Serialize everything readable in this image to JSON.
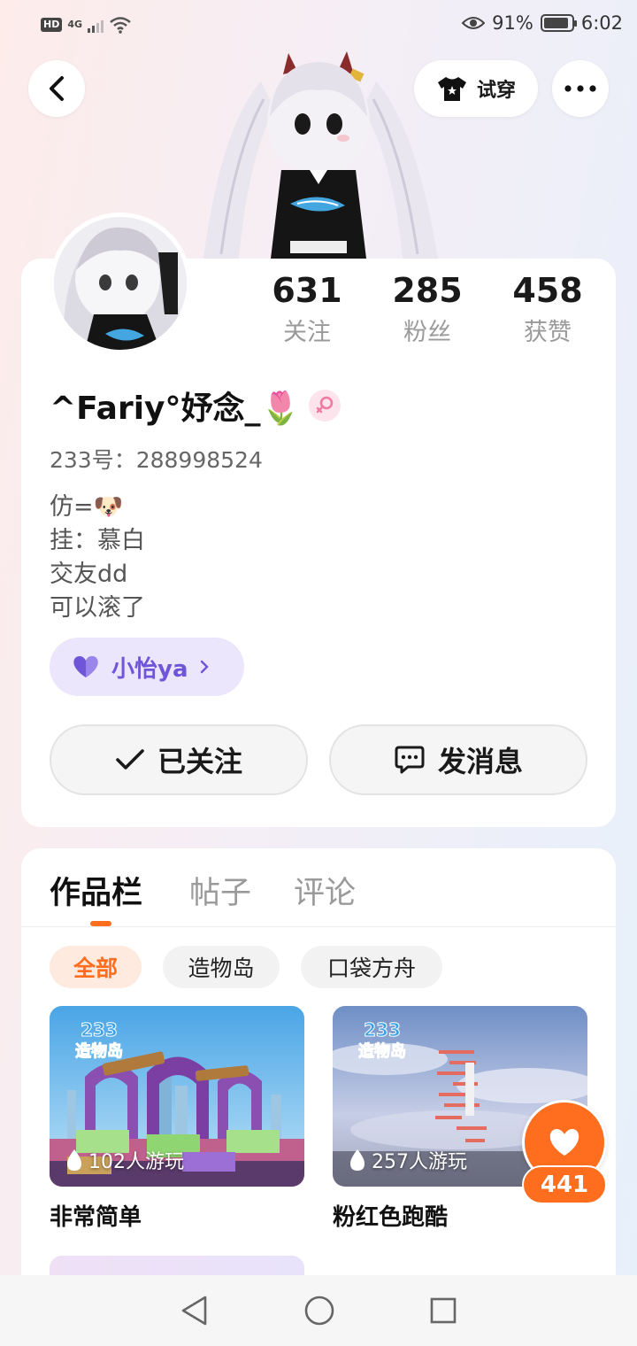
{
  "status_bar": {
    "hd": "HD",
    "network": "4G",
    "battery_percent": "91%",
    "time": "6:02",
    "battery_level": 0.91
  },
  "header": {
    "tryon_label": "试穿"
  },
  "profile": {
    "stats": [
      {
        "value": "631",
        "label": "关注"
      },
      {
        "value": "285",
        "label": "粉丝"
      },
      {
        "value": "458",
        "label": "获赞"
      }
    ],
    "nickname": "^Fariy°妤念_🌷",
    "uid": "233号：288998524",
    "bio": [
      "仿=🐶",
      "挂：慕白",
      "交友dd",
      "可以滚了"
    ],
    "cp_tag": "小怡ya",
    "follow_label": "已关注",
    "message_label": "发消息",
    "gender_icon": "female-icon",
    "accent_color": "#ff6d1f",
    "cp_color": "#6f55d8"
  },
  "works": {
    "tabs": [
      "作品栏",
      "帖子",
      "评论"
    ],
    "filters": [
      "全部",
      "造物岛",
      "口袋方舟"
    ],
    "games": [
      {
        "title": "非常简单",
        "plays": "102人游玩",
        "badge_num": "233",
        "badge_text": "造物岛"
      },
      {
        "title": "粉红色跑酷",
        "plays": "257人游玩",
        "badge_num": "233",
        "badge_text": "造物岛"
      }
    ]
  },
  "like": {
    "count": "441"
  }
}
